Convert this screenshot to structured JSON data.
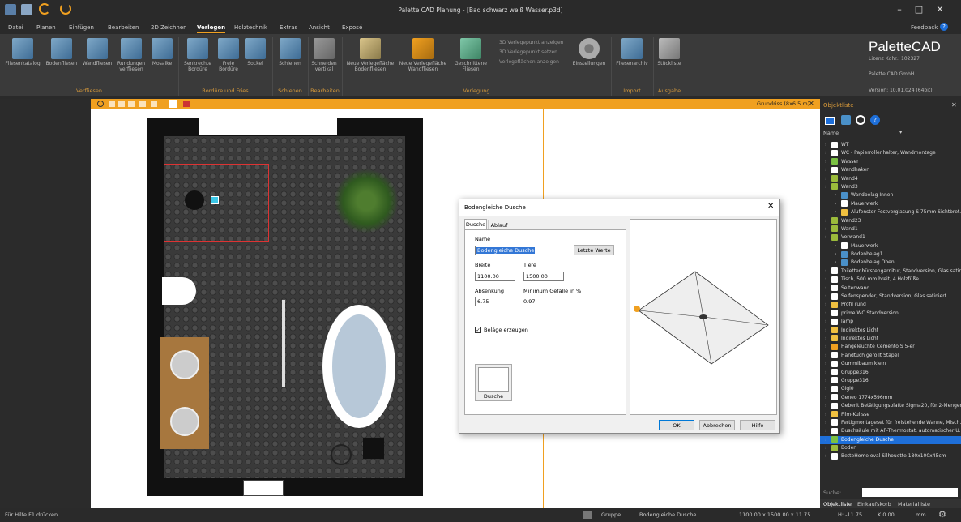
{
  "app": {
    "title": "Palette CAD Planung - [Bad schwarz weiß Wasser.p3d]",
    "feedback": "Feedback",
    "help": "?"
  },
  "menu": [
    {
      "label": "Datei"
    },
    {
      "label": "Planen"
    },
    {
      "label": "Einfügen"
    },
    {
      "label": "Bearbeiten"
    },
    {
      "label": "2D Zeichnen"
    },
    {
      "label": "Verlegen",
      "active": true
    },
    {
      "label": "Holztechnik"
    },
    {
      "label": "Extras"
    },
    {
      "label": "Ansicht"
    },
    {
      "label": "Exposé"
    }
  ],
  "ribbon": {
    "buttons": [
      "Fliesenkatalog",
      "Bodenfliesen",
      "Wandfliesen",
      "Rundungen verfliesen",
      "Mosaike",
      "Senkrechte Bordüre",
      "Freie Bordüre",
      "Sockel",
      "Schienen",
      "Schneiden vertikal",
      "Neue Verlegefläche Bodenfliesen",
      "Neue Verlegefläche Wandfliesen",
      "Geschnittene Fliesen",
      "Einstellungen",
      "Fliesenarchiv",
      "Stückliste"
    ],
    "small": [
      "3D Verlegepunkt anzeigen",
      "3D Verlegepunkt setzen",
      "Verlegeflächen anzeigen"
    ],
    "groups": [
      "Verfliesen",
      "Bordüre und Fries",
      "Schienen",
      "Bearbeiten",
      "Verlegung",
      "Import",
      "Ausgabe"
    ]
  },
  "logo": {
    "brand": "PaletteCAD",
    "license": "Lizenz Kdhr.: 102327",
    "company": "Palette CAD GmbH",
    "version": "Version: 10.01.024 (64bit)"
  },
  "doc": {
    "view": "Grundriss (8x6.5 m)"
  },
  "dialog": {
    "title": "Bodengleiche Dusche",
    "tabs": [
      "Dusche",
      "Ablauf"
    ],
    "name_label": "Name",
    "name_value": "Bodengleiche Dusche",
    "last_values": "Letzte Werte",
    "width_label": "Breite",
    "width_value": "1100.00",
    "depth_label": "Tiefe",
    "depth_value": "1500.00",
    "drop_label": "Absenkung",
    "drop_value": "6.75",
    "slope_label": "Minimum Gefälle in %",
    "slope_value": "0.97",
    "coverings": "Beläge erzeugen",
    "preview_label": "Dusche",
    "ok": "OK",
    "cancel": "Abbrechen",
    "help": "Hilfe"
  },
  "objects": {
    "title": "Objektliste",
    "column": "Name",
    "search_label": "Suche:",
    "tabs": [
      "Objektliste",
      "Einkaufskorb",
      "Materialliste"
    ],
    "items": [
      {
        "label": "WT",
        "color": "#ffffff"
      },
      {
        "label": "WC - Papierrollenhalter, Wandmontage",
        "color": "#ffffff"
      },
      {
        "label": "Wasser",
        "color": "#7ac143"
      },
      {
        "label": "Wandhaken",
        "color": "#ffffff"
      },
      {
        "label": "Wand4",
        "color": "#9bbb3b"
      },
      {
        "label": "Wand3",
        "color": "#9bbb3b"
      },
      {
        "label": "Wandbelag Innen",
        "color": "#4a90c8"
      },
      {
        "label": "Mauerwerk",
        "color": "#ffffff"
      },
      {
        "label": "Alufenster Festverglasung S 75mm Sichtbret...",
        "color": "#f0c040"
      },
      {
        "label": "Wand23",
        "color": "#9bbb3b"
      },
      {
        "label": "Wand1",
        "color": "#9bbb3b"
      },
      {
        "label": "Vorwand1",
        "color": "#9bbb3b"
      },
      {
        "label": "Mauerwerk",
        "color": "#ffffff"
      },
      {
        "label": "Bodenbelag1",
        "color": "#4a90c8"
      },
      {
        "label": "Bodenbelag Oben",
        "color": "#4a90c8"
      },
      {
        "label": "Toilettenbürstengarnitur, Standversion, Glas satin...",
        "color": "#ffffff"
      },
      {
        "label": "Tisch, 500 mm breit, 4 Holzfüße",
        "color": "#ffffff"
      },
      {
        "label": "Seitenwand",
        "color": "#ffffff"
      },
      {
        "label": "Seifenspender, Standversion, Glas satiniert",
        "color": "#ffffff"
      },
      {
        "label": "Profil rund",
        "color": "#f0c040"
      },
      {
        "label": "prime WC Standversion",
        "color": "#ffffff"
      },
      {
        "label": "lamp",
        "color": "#ffffff"
      },
      {
        "label": "Indirektes Licht",
        "color": "#f0c040"
      },
      {
        "label": "Indirektes Licht",
        "color": "#f0c040"
      },
      {
        "label": "Hängeleuchte Cemento S 5-er",
        "color": "#f0a020"
      },
      {
        "label": "Handtuch gerollt Stapel",
        "color": "#ffffff"
      },
      {
        "label": "Gummibaum klein",
        "color": "#ffffff"
      },
      {
        "label": "Gruppe316",
        "color": "#ffffff"
      },
      {
        "label": "Gruppe316",
        "color": "#ffffff"
      },
      {
        "label": "Gigi0",
        "color": "#ffffff"
      },
      {
        "label": "Geneo 1774x596mm",
        "color": "#ffffff"
      },
      {
        "label": "Geberit Betätigungsplatte Sigma20, für 2-Mengen",
        "color": "#ffffff"
      },
      {
        "label": "Film-Kulisse",
        "color": "#f0c040"
      },
      {
        "label": "Fertigmontageset für freistehende Wanne, Misch...",
        "color": "#ffffff"
      },
      {
        "label": "Duschsäule mit AP-Thermostat, automatischer U...",
        "color": "#ffffff"
      },
      {
        "label": "Bodengleiche Dusche",
        "color": "#7ac143",
        "selected": true
      },
      {
        "label": "Boden",
        "color": "#9bbb3b"
      },
      {
        "label": "BetteHome oval Silhouette 180x100x45cm",
        "color": "#ffffff"
      }
    ]
  },
  "status": {
    "help": "Für Hilfe F1 drücken",
    "group": "Gruppe",
    "object": "Bodengleiche Dusche",
    "dims": "1100.00 x 1500.00 x 11.75",
    "h": "H: -11.75",
    "k": "K 0.00",
    "unit": "mm"
  }
}
